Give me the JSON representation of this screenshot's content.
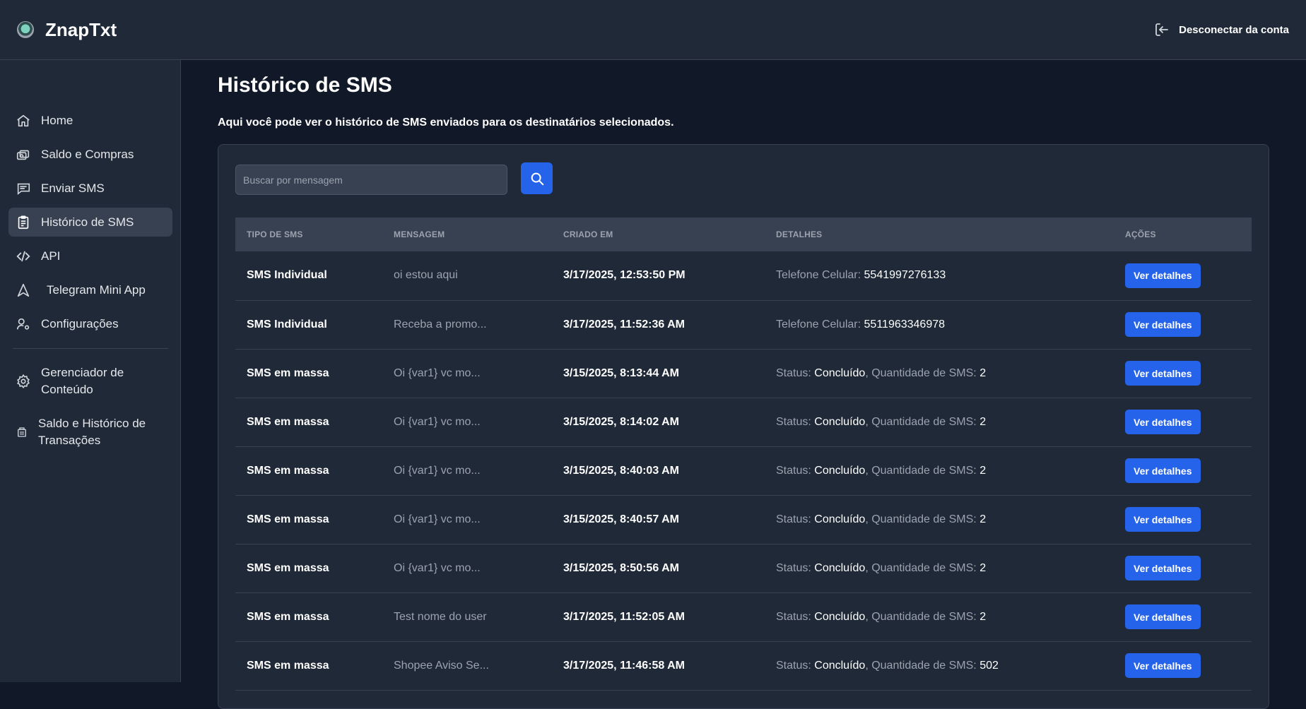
{
  "header": {
    "brand": "ZnapTxt",
    "logout_label": "Desconectar da conta"
  },
  "sidebar": {
    "items": [
      {
        "label": "Home",
        "icon": "home-icon",
        "active": false
      },
      {
        "label": "Saldo e Compras",
        "icon": "wallet-icon",
        "active": false
      },
      {
        "label": "Enviar SMS",
        "icon": "message-icon",
        "active": false
      },
      {
        "label": "Histórico de SMS",
        "icon": "clipboard-icon",
        "active": true
      },
      {
        "label": "API",
        "icon": "code-icon",
        "active": false
      },
      {
        "label": "Telegram Mini App",
        "icon": "triangle-icon",
        "active": false
      },
      {
        "label": "Configurações",
        "icon": "user-settings-icon",
        "active": false
      }
    ],
    "admin_items": [
      {
        "label_line1": "Gerenciador de",
        "label_line2": "Conteúdo",
        "icon": "gear-icon"
      },
      {
        "label_line1": "Saldo e Histórico de",
        "label_line2": "Transações",
        "icon": "receipt-icon"
      }
    ]
  },
  "main": {
    "title": "Histórico de SMS",
    "description": "Aqui você pode ver o histórico de SMS enviados para os destinatários selecionados.",
    "search_placeholder": "Buscar por mensagem",
    "search_value": ""
  },
  "table": {
    "columns": [
      "TIPO DE SMS",
      "MENSAGEM",
      "CRIADO EM",
      "DETALHES",
      "AÇÕES"
    ],
    "action_label": "Ver detalhes",
    "rows": [
      {
        "type": "SMS Individual",
        "message": "oi estou aqui",
        "created": "3/17/2025, 12:53:50 PM",
        "detail_kind": "phone",
        "phone_label": "Telefone Celular:",
        "phone": "5541997276133"
      },
      {
        "type": "SMS Individual",
        "message": "Receba a promo...",
        "created": "3/17/2025, 11:52:36 AM",
        "detail_kind": "phone",
        "phone_label": "Telefone Celular:",
        "phone": "5511963346978"
      },
      {
        "type": "SMS em massa",
        "message": "Oi {var1} vc mo...",
        "created": "3/15/2025, 8:13:44 AM",
        "detail_kind": "bulk",
        "status_label": "Status:",
        "status": "Concluído",
        "qty_label": "Quantidade de SMS:",
        "qty": "2"
      },
      {
        "type": "SMS em massa",
        "message": "Oi {var1} vc mo...",
        "created": "3/15/2025, 8:14:02 AM",
        "detail_kind": "bulk",
        "status_label": "Status:",
        "status": "Concluído",
        "qty_label": "Quantidade de SMS:",
        "qty": "2"
      },
      {
        "type": "SMS em massa",
        "message": "Oi {var1} vc mo...",
        "created": "3/15/2025, 8:40:03 AM",
        "detail_kind": "bulk",
        "status_label": "Status:",
        "status": "Concluído",
        "qty_label": "Quantidade de SMS:",
        "qty": "2"
      },
      {
        "type": "SMS em massa",
        "message": "Oi {var1} vc mo...",
        "created": "3/15/2025, 8:40:57 AM",
        "detail_kind": "bulk",
        "status_label": "Status:",
        "status": "Concluído",
        "qty_label": "Quantidade de SMS:",
        "qty": "2"
      },
      {
        "type": "SMS em massa",
        "message": "Oi {var1} vc mo...",
        "created": "3/15/2025, 8:50:56 AM",
        "detail_kind": "bulk",
        "status_label": "Status:",
        "status": "Concluído",
        "qty_label": "Quantidade de SMS:",
        "qty": "2"
      },
      {
        "type": "SMS em massa",
        "message": "Test nome do user",
        "created": "3/17/2025, 11:52:05 AM",
        "detail_kind": "bulk",
        "status_label": "Status:",
        "status": "Concluído",
        "qty_label": "Quantidade de SMS:",
        "qty": "2"
      },
      {
        "type": "SMS em massa",
        "message": "Shopee Aviso Se...",
        "created": "3/17/2025, 11:46:58 AM",
        "detail_kind": "bulk",
        "status_label": "Status:",
        "status": "Concluído",
        "qty_label": "Quantidade de SMS:",
        "qty": "502"
      }
    ]
  },
  "colors": {
    "background": "#111827",
    "panel": "#1f2937",
    "accent": "#2563eb"
  }
}
